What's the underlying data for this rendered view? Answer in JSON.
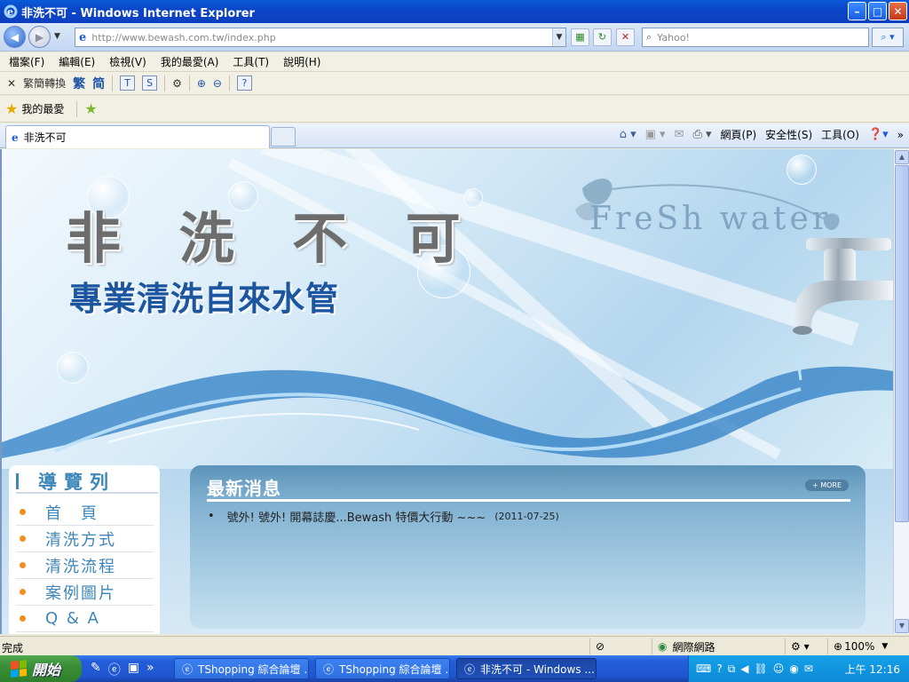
{
  "window": {
    "title": "非洗不可 - Windows Internet Explorer",
    "min": "–",
    "max": "□",
    "close": "✕"
  },
  "address": {
    "url": "http://www.bewash.com.tw/index.php",
    "search_placeholder": "Yahoo!"
  },
  "menu": [
    "檔案(F)",
    "編輯(E)",
    "檢視(V)",
    "我的最愛(A)",
    "工具(T)",
    "說明(H)"
  ],
  "toolbar2": {
    "convert": "繁簡轉換",
    "trad": "繁",
    "simp": "简"
  },
  "favorites": {
    "label": "我的最愛"
  },
  "tab": {
    "title": "非洗不可"
  },
  "commandbar": {
    "page": "網頁(P)",
    "safety": "安全性(S)",
    "tools": "工具(O)"
  },
  "page": {
    "title": "非 洗 不 可",
    "subtitle": "專業清洗自來水管",
    "logo_text": "FreSh water",
    "nav_heading": "導覽列",
    "nav_items": [
      "首　頁",
      "清洗方式",
      "清洗流程",
      "案例圖片",
      "Q & A"
    ],
    "news_heading": "最新消息",
    "more": "+ MORE",
    "news": [
      {
        "text": "號外! 號外! 開幕誌慶...Bewash 特價大行動 ~~~",
        "date": "(2011-07-25)"
      }
    ]
  },
  "status": {
    "text": "完成",
    "zone": "網際網路",
    "zoom": "100%"
  },
  "taskbar": {
    "start": "開始",
    "tasks": [
      "TShopping 綜合論壇 ...",
      "TShopping 綜合論壇 ...",
      "非洗不可 - Windows ..."
    ],
    "clock": "上午 12:16"
  }
}
